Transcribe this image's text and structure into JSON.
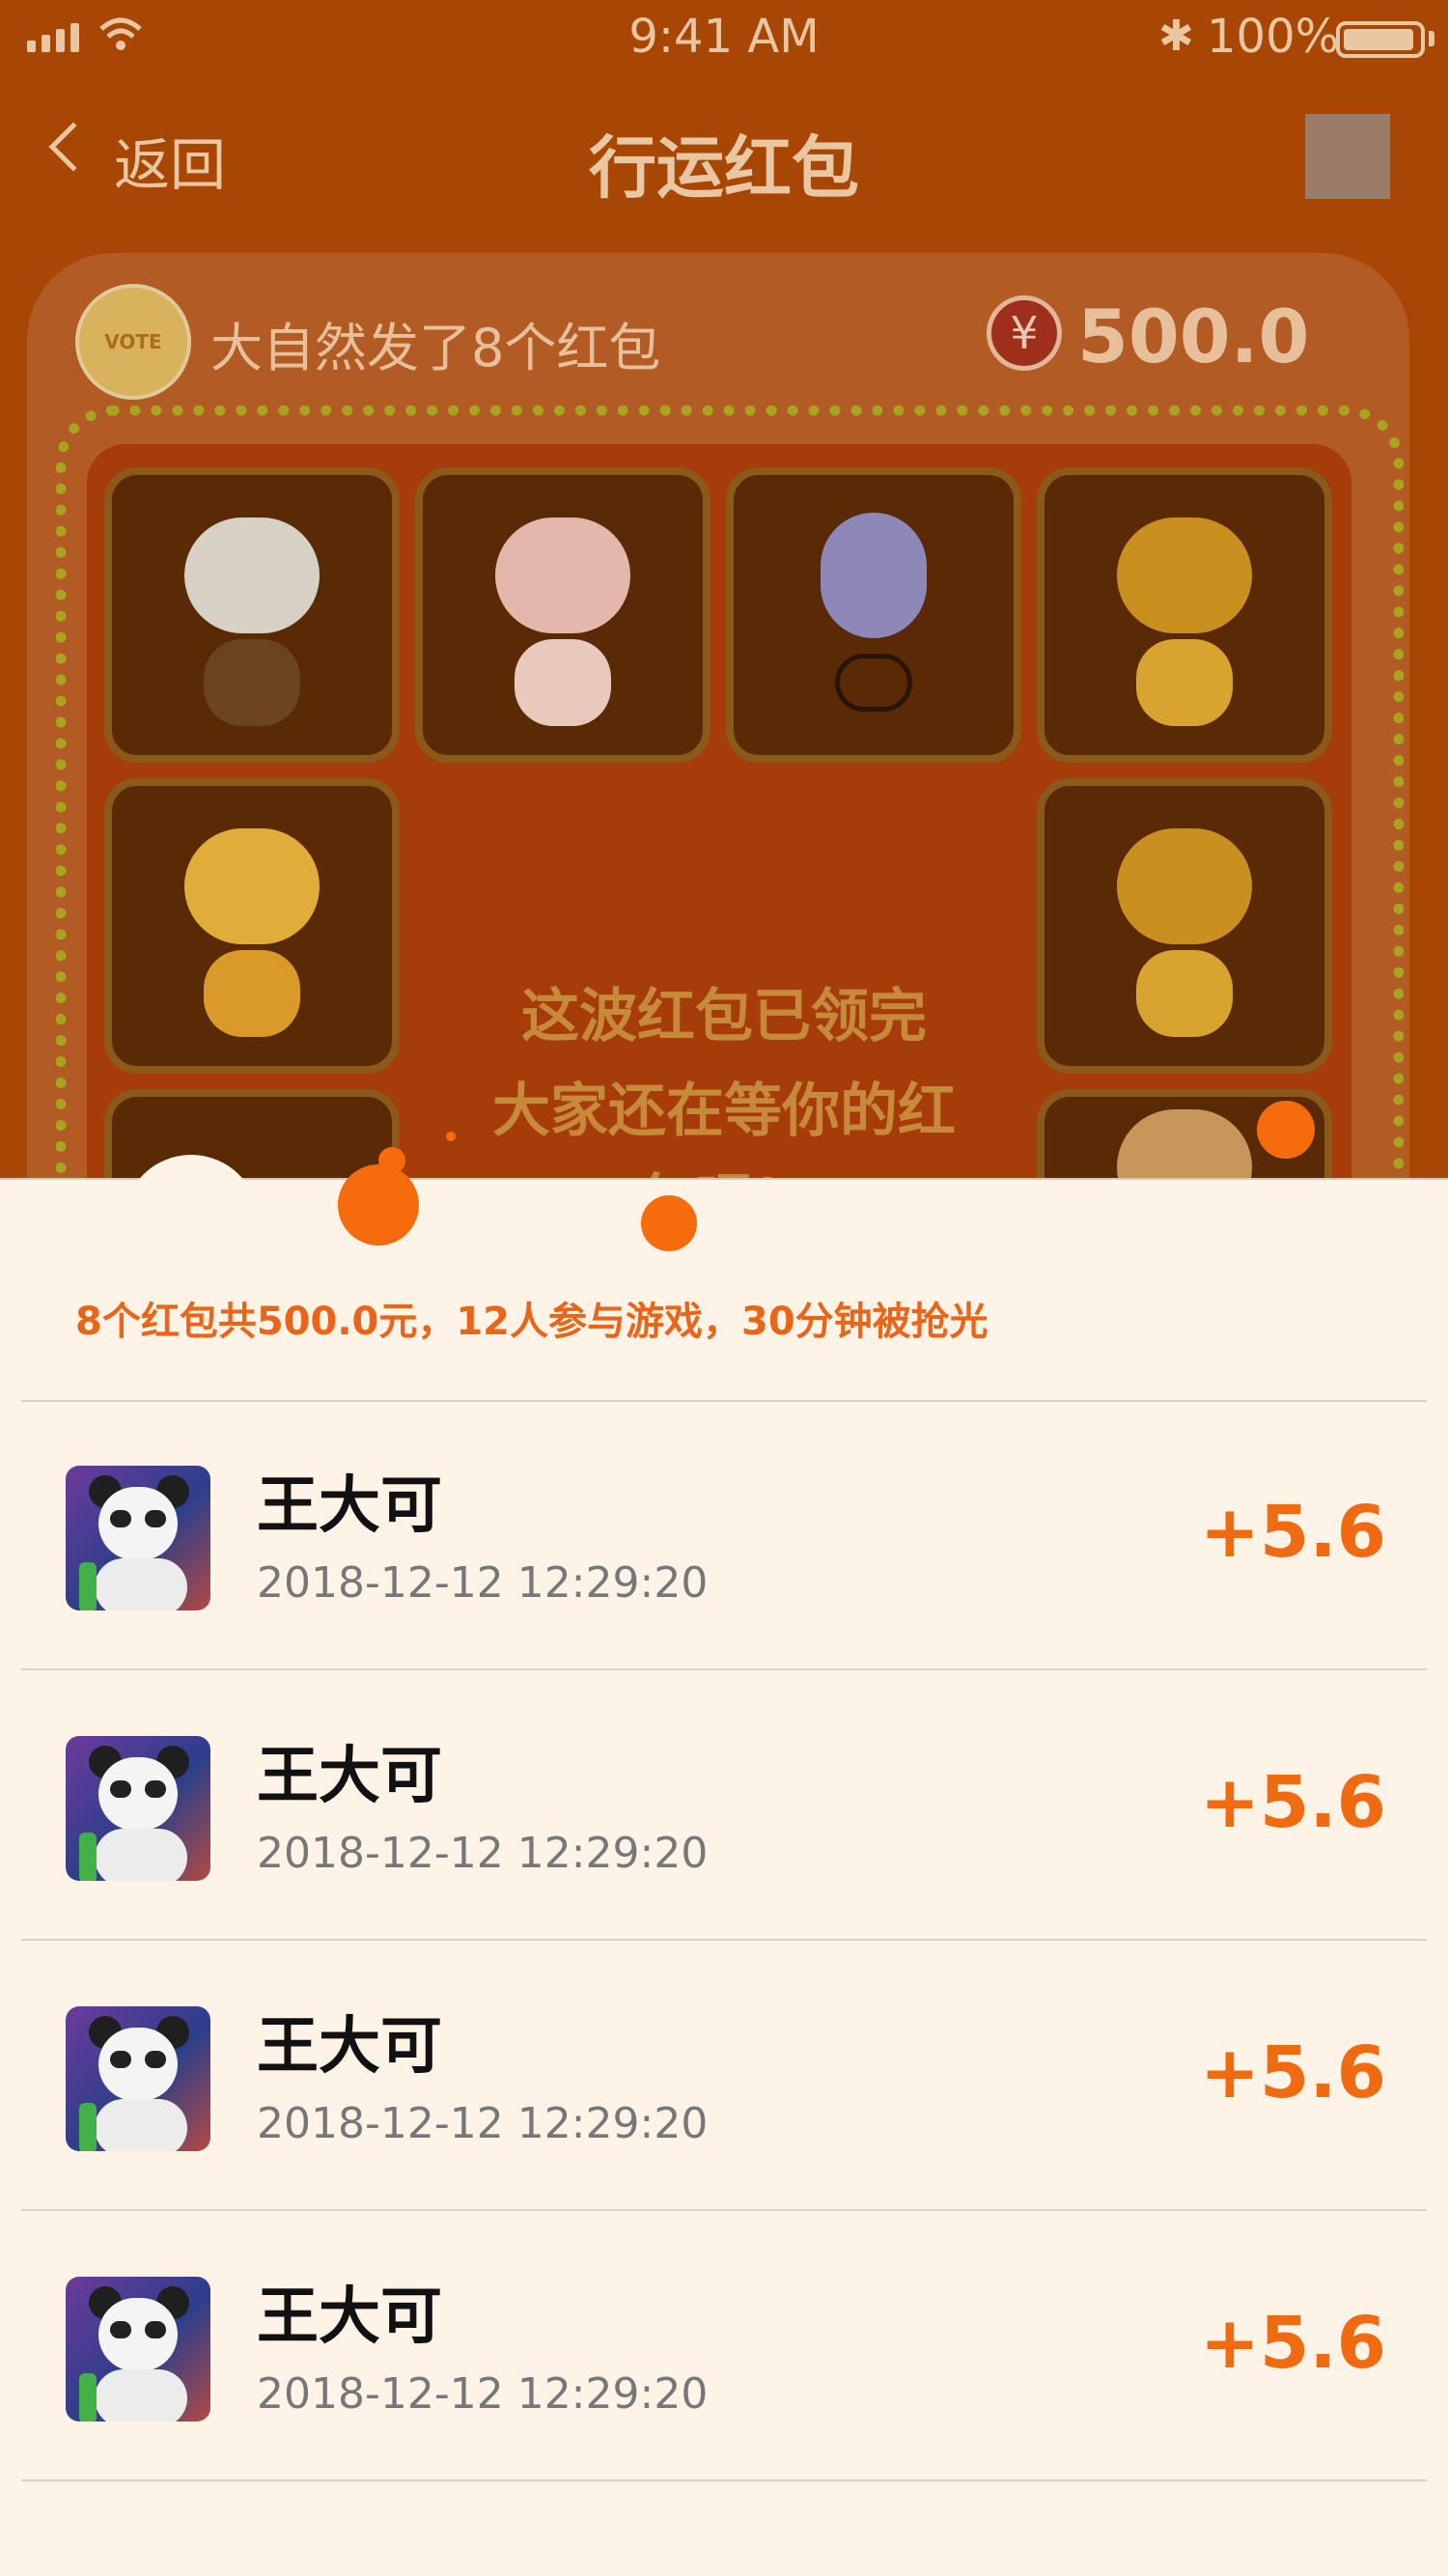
{
  "status_bar": {
    "time": "9:41 AM",
    "battery": "100%"
  },
  "nav": {
    "back_label": "返回",
    "title": "行运红包"
  },
  "header": {
    "host_avatar_text": "VOTE",
    "host_text": "大自然发了8个红包",
    "currency_symbol": "¥",
    "amount": "500.0"
  },
  "board": {
    "done_line1": "这波红包已领完",
    "done_line2": "大家还在等你的红",
    "done_line3": "包呢！",
    "tiles": [
      {
        "animal": "monkey",
        "color": "#c9c2b4"
      },
      {
        "animal": "pig",
        "color": "#e2b6a9"
      },
      {
        "animal": "snake",
        "color": "#8a86b4"
      },
      {
        "animal": "horse",
        "color": "#c98f1f"
      },
      {
        "animal": "tiger",
        "color": "#d9a330"
      },
      {
        "animal": "horse",
        "color": "#c98f1f"
      }
    ]
  },
  "summary": "8个红包共500.0元，12人参与游戏，30分钟被抢光",
  "records": [
    {
      "name": "王大可",
      "time": "2018-12-12 12:29:20",
      "amount": "+5.6"
    },
    {
      "name": "王大可",
      "time": "2018-12-12 12:29:20",
      "amount": "+5.6"
    },
    {
      "name": "王大可",
      "time": "2018-12-12 12:29:20",
      "amount": "+5.6"
    },
    {
      "name": "王大可",
      "time": "2018-12-12 12:29:20",
      "amount": "+5.6"
    }
  ],
  "colors": {
    "accent": "#f06a12",
    "background": "#a84604",
    "sheet": "#fef3e7"
  }
}
